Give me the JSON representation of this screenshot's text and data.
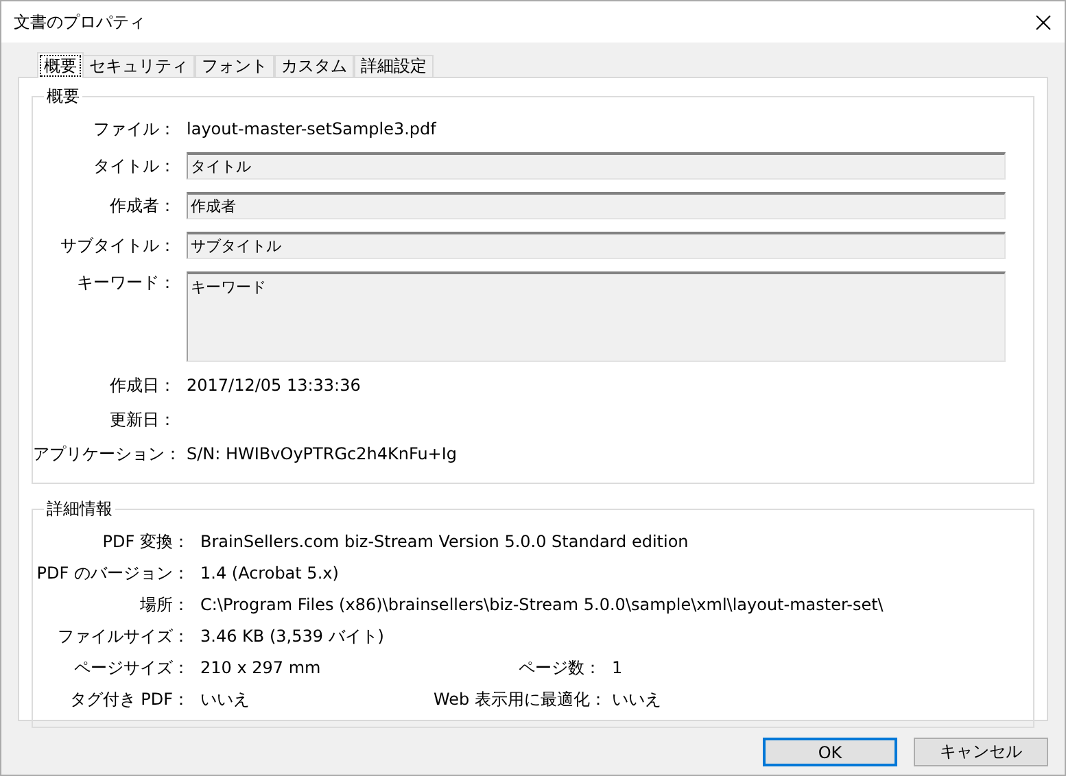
{
  "window": {
    "title": "文書のプロパティ"
  },
  "tabs": [
    {
      "label": "概要",
      "selected": true
    },
    {
      "label": "セキュリティ",
      "selected": false
    },
    {
      "label": "フォント",
      "selected": false
    },
    {
      "label": "カスタム",
      "selected": false
    },
    {
      "label": "詳細設定",
      "selected": false
    }
  ],
  "summary": {
    "title": "概要",
    "fields": [
      {
        "label": "ファイル：",
        "kind": "text",
        "value": "layout-master-setSample3.pdf"
      },
      {
        "label": "タイトル：",
        "kind": "input",
        "value": "タイトル"
      },
      {
        "label": "作成者：",
        "kind": "input",
        "value": "作成者"
      },
      {
        "label": "サブタイトル：",
        "kind": "input",
        "value": "サブタイトル"
      },
      {
        "label": "キーワード：",
        "kind": "textarea",
        "value": "キーワード"
      },
      {
        "label": "作成日：",
        "kind": "text",
        "value": "2017/12/05 13:33:36"
      },
      {
        "label": "更新日：",
        "kind": "text"
      },
      {
        "label": "アプリケーション：",
        "kind": "text",
        "value": "S/N: HWIBvOyPTRGc2h4KnFu+Ig"
      }
    ]
  },
  "details": {
    "title": "詳細情報",
    "rows": [
      [
        {
          "label": "PDF 変換：",
          "value": "BrainSellers.com biz-Stream Version 5.0.0 Standard edition"
        }
      ],
      [
        {
          "label": "PDF のバージョン：",
          "value": "1.4 (Acrobat 5.x)"
        }
      ],
      [
        {
          "label": "場所：",
          "value": "C:\\Program Files (x86)\\brainsellers\\biz-Stream 5.0.0\\sample\\xml\\layout-master-set\\"
        }
      ],
      [
        {
          "label": "ファイルサイズ：",
          "value": "3.46 KB (3,539 バイト)"
        }
      ],
      [
        {
          "label": "ページサイズ：",
          "value": "210 x 297 mm"
        },
        {
          "label": "ページ数：",
          "value": "1"
        }
      ],
      [
        {
          "label": "タグ付き PDF：",
          "value": "いいえ"
        },
        {
          "label": "Web 表示用に最適化：",
          "value": "いいえ"
        }
      ]
    ]
  },
  "buttons": [
    {
      "label": "OK",
      "default": true
    },
    {
      "label": "キャンセル",
      "default": false
    }
  ]
}
